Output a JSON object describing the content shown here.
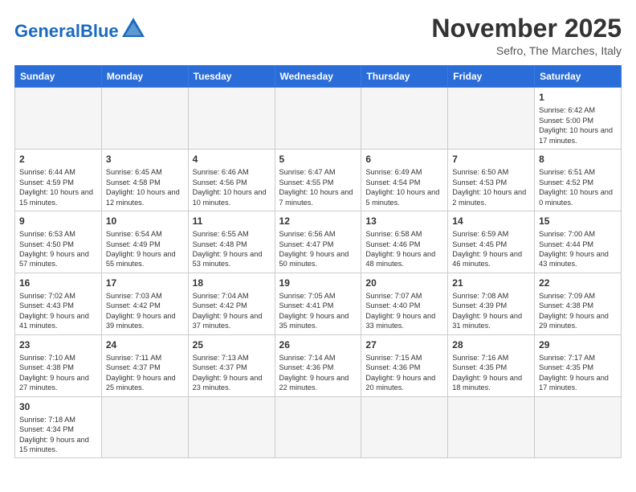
{
  "header": {
    "logo_general": "General",
    "logo_blue": "Blue",
    "month": "November 2025",
    "location": "Sefro, The Marches, Italy"
  },
  "days_of_week": [
    "Sunday",
    "Monday",
    "Tuesday",
    "Wednesday",
    "Thursday",
    "Friday",
    "Saturday"
  ],
  "weeks": [
    [
      {
        "day": "",
        "info": ""
      },
      {
        "day": "",
        "info": ""
      },
      {
        "day": "",
        "info": ""
      },
      {
        "day": "",
        "info": ""
      },
      {
        "day": "",
        "info": ""
      },
      {
        "day": "",
        "info": ""
      },
      {
        "day": "1",
        "info": "Sunrise: 6:42 AM\nSunset: 5:00 PM\nDaylight: 10 hours and 17 minutes."
      }
    ],
    [
      {
        "day": "2",
        "info": "Sunrise: 6:44 AM\nSunset: 4:59 PM\nDaylight: 10 hours and 15 minutes."
      },
      {
        "day": "3",
        "info": "Sunrise: 6:45 AM\nSunset: 4:58 PM\nDaylight: 10 hours and 12 minutes."
      },
      {
        "day": "4",
        "info": "Sunrise: 6:46 AM\nSunset: 4:56 PM\nDaylight: 10 hours and 10 minutes."
      },
      {
        "day": "5",
        "info": "Sunrise: 6:47 AM\nSunset: 4:55 PM\nDaylight: 10 hours and 7 minutes."
      },
      {
        "day": "6",
        "info": "Sunrise: 6:49 AM\nSunset: 4:54 PM\nDaylight: 10 hours and 5 minutes."
      },
      {
        "day": "7",
        "info": "Sunrise: 6:50 AM\nSunset: 4:53 PM\nDaylight: 10 hours and 2 minutes."
      },
      {
        "day": "8",
        "info": "Sunrise: 6:51 AM\nSunset: 4:52 PM\nDaylight: 10 hours and 0 minutes."
      }
    ],
    [
      {
        "day": "9",
        "info": "Sunrise: 6:53 AM\nSunset: 4:50 PM\nDaylight: 9 hours and 57 minutes."
      },
      {
        "day": "10",
        "info": "Sunrise: 6:54 AM\nSunset: 4:49 PM\nDaylight: 9 hours and 55 minutes."
      },
      {
        "day": "11",
        "info": "Sunrise: 6:55 AM\nSunset: 4:48 PM\nDaylight: 9 hours and 53 minutes."
      },
      {
        "day": "12",
        "info": "Sunrise: 6:56 AM\nSunset: 4:47 PM\nDaylight: 9 hours and 50 minutes."
      },
      {
        "day": "13",
        "info": "Sunrise: 6:58 AM\nSunset: 4:46 PM\nDaylight: 9 hours and 48 minutes."
      },
      {
        "day": "14",
        "info": "Sunrise: 6:59 AM\nSunset: 4:45 PM\nDaylight: 9 hours and 46 minutes."
      },
      {
        "day": "15",
        "info": "Sunrise: 7:00 AM\nSunset: 4:44 PM\nDaylight: 9 hours and 43 minutes."
      }
    ],
    [
      {
        "day": "16",
        "info": "Sunrise: 7:02 AM\nSunset: 4:43 PM\nDaylight: 9 hours and 41 minutes."
      },
      {
        "day": "17",
        "info": "Sunrise: 7:03 AM\nSunset: 4:42 PM\nDaylight: 9 hours and 39 minutes."
      },
      {
        "day": "18",
        "info": "Sunrise: 7:04 AM\nSunset: 4:42 PM\nDaylight: 9 hours and 37 minutes."
      },
      {
        "day": "19",
        "info": "Sunrise: 7:05 AM\nSunset: 4:41 PM\nDaylight: 9 hours and 35 minutes."
      },
      {
        "day": "20",
        "info": "Sunrise: 7:07 AM\nSunset: 4:40 PM\nDaylight: 9 hours and 33 minutes."
      },
      {
        "day": "21",
        "info": "Sunrise: 7:08 AM\nSunset: 4:39 PM\nDaylight: 9 hours and 31 minutes."
      },
      {
        "day": "22",
        "info": "Sunrise: 7:09 AM\nSunset: 4:38 PM\nDaylight: 9 hours and 29 minutes."
      }
    ],
    [
      {
        "day": "23",
        "info": "Sunrise: 7:10 AM\nSunset: 4:38 PM\nDaylight: 9 hours and 27 minutes."
      },
      {
        "day": "24",
        "info": "Sunrise: 7:11 AM\nSunset: 4:37 PM\nDaylight: 9 hours and 25 minutes."
      },
      {
        "day": "25",
        "info": "Sunrise: 7:13 AM\nSunset: 4:37 PM\nDaylight: 9 hours and 23 minutes."
      },
      {
        "day": "26",
        "info": "Sunrise: 7:14 AM\nSunset: 4:36 PM\nDaylight: 9 hours and 22 minutes."
      },
      {
        "day": "27",
        "info": "Sunrise: 7:15 AM\nSunset: 4:36 PM\nDaylight: 9 hours and 20 minutes."
      },
      {
        "day": "28",
        "info": "Sunrise: 7:16 AM\nSunset: 4:35 PM\nDaylight: 9 hours and 18 minutes."
      },
      {
        "day": "29",
        "info": "Sunrise: 7:17 AM\nSunset: 4:35 PM\nDaylight: 9 hours and 17 minutes."
      }
    ],
    [
      {
        "day": "30",
        "info": "Sunrise: 7:18 AM\nSunset: 4:34 PM\nDaylight: 9 hours and 15 minutes."
      },
      {
        "day": "",
        "info": ""
      },
      {
        "day": "",
        "info": ""
      },
      {
        "day": "",
        "info": ""
      },
      {
        "day": "",
        "info": ""
      },
      {
        "day": "",
        "info": ""
      },
      {
        "day": "",
        "info": ""
      }
    ]
  ]
}
